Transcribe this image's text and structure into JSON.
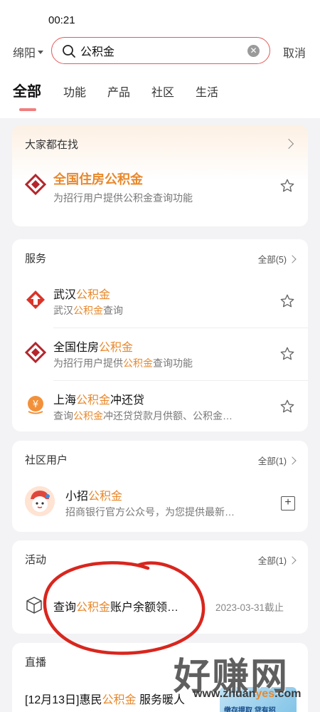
{
  "status_bar": {
    "time": "00:21"
  },
  "search": {
    "city": "绵阳",
    "query": "公积金",
    "cancel_label": "取消"
  },
  "tabs": [
    "全部",
    "功能",
    "产品",
    "社区",
    "生活"
  ],
  "trending": {
    "title": "大家都在找",
    "item": {
      "name": "全国住房公积金",
      "desc": "为招行用户提供公积金查询功能"
    }
  },
  "services": {
    "title": "服务",
    "more_label": "全部(5)",
    "items": [
      {
        "name_pre": "武汉",
        "name_hl": "公积金",
        "name_post": "",
        "sub_pre": "武汉",
        "sub_hl": "公积金",
        "sub_post": "查询"
      },
      {
        "name_pre": "全国住房",
        "name_hl": "公积金",
        "name_post": "",
        "sub_pre": "为招行用户提供",
        "sub_hl": "公积金",
        "sub_post": "查询功能"
      },
      {
        "name_pre": "上海",
        "name_hl": "公积金",
        "name_post": "冲还贷",
        "sub_pre": "查询",
        "sub_hl": "公积金",
        "sub_post": "冲还贷贷款月供额、公积金…"
      }
    ]
  },
  "community": {
    "title": "社区用户",
    "more_label": "全部(1)",
    "user": {
      "name_pre": "小招",
      "name_hl": "公积金",
      "desc": "招商银行官方公众号，为您提供最新…"
    }
  },
  "activities": {
    "title": "活动",
    "more_label": "全部(1)",
    "item": {
      "name_pre": "查询",
      "name_hl": "公积金",
      "name_post": "账户余额领…",
      "date": "2023-03-31截止"
    }
  },
  "live": {
    "title": "直播",
    "item": {
      "name_pre": "[12月13日]惠民",
      "name_hl": "公积金",
      "name_post": " 服务暖人"
    },
    "thumb_text": "缴存提取 贷有招"
  },
  "watermark": {
    "big": "好赚网",
    "url_a": "www.zhuan",
    "url_b": "yes",
    "url_c": ".com"
  },
  "colors": {
    "accent": "#e8882b",
    "search_border": "#e25b5b",
    "tab_indicator": "#f07e7e",
    "circle_annotation": "#d8261e"
  }
}
